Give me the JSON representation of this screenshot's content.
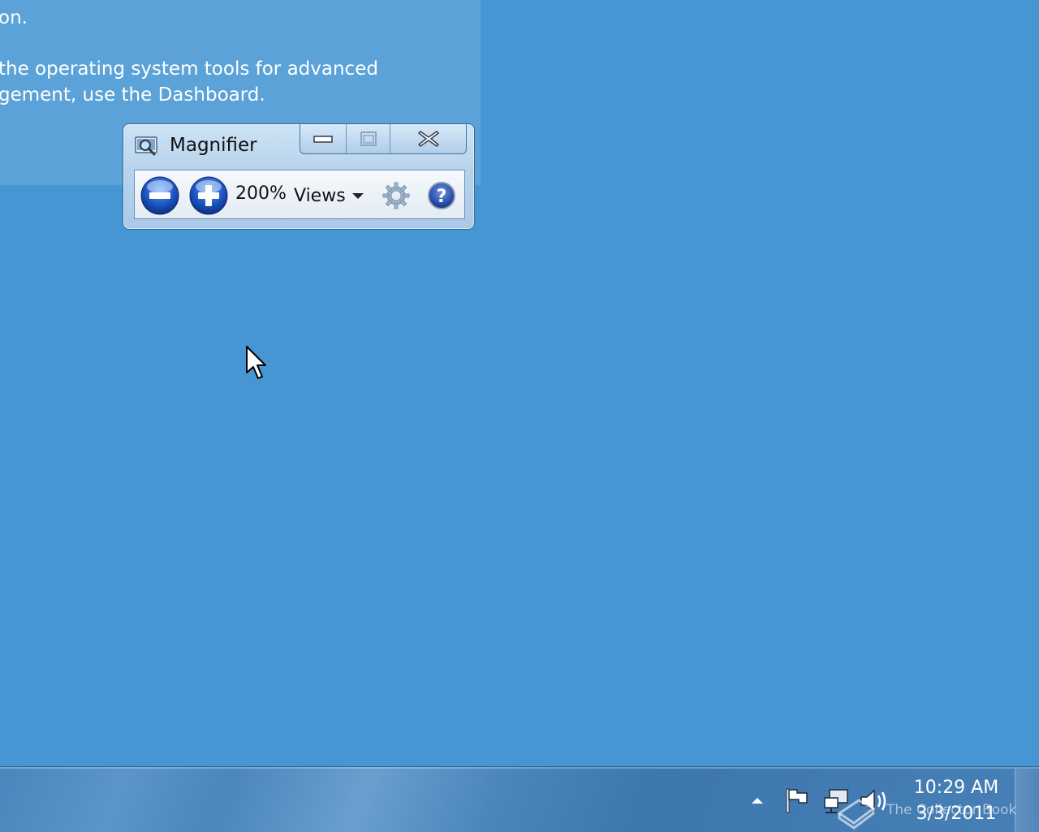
{
  "background_window": {
    "line1": "on.",
    "line2": "the operating system tools for advanced",
    "line3": "gement, use the Dashboard."
  },
  "magnifier": {
    "title": "Magnifier",
    "zoom_level": "200%",
    "views_label": "Views",
    "icons": {
      "app": "magnifier-icon",
      "zoom_out": "minus-icon",
      "zoom_in": "plus-icon",
      "views_dropdown": "dropdown-arrow-icon",
      "settings": "gear-icon",
      "help": "question-mark-icon"
    }
  },
  "taskbar": {
    "clock": {
      "time": "10:29 AM",
      "date": "3/3/2011"
    },
    "tray_icons": [
      "up-arrow-icon",
      "flag-icon",
      "network-icon",
      "volume-icon"
    ]
  },
  "watermark": {
    "text": "The Collector Book"
  },
  "colors": {
    "desktop": "#4596d2",
    "zoom_button": "#1d56c4",
    "help_button": "#2a4fae"
  }
}
